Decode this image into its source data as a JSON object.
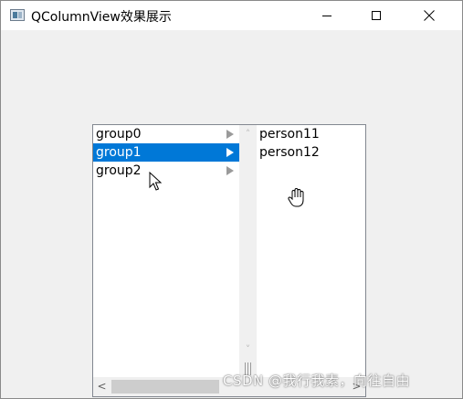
{
  "window": {
    "title": "QColumnView效果展示",
    "controls": {
      "minimize": "minimize-icon",
      "maximize": "maximize-icon",
      "close": "close-icon"
    }
  },
  "column_view": {
    "groups": [
      {
        "label": "group0",
        "selected": false
      },
      {
        "label": "group1",
        "selected": true
      },
      {
        "label": "group2",
        "selected": false
      }
    ],
    "children": [
      "person11",
      "person12"
    ],
    "selection_color": "#0078d7"
  },
  "scrollbars": {
    "vertical": {
      "up": "˄",
      "down": "˅"
    },
    "horizontal": {
      "left": "<",
      "right": ">"
    }
  },
  "cursors": {
    "arrow": "arrow-cursor-icon",
    "hand": "open-hand-cursor-icon"
  },
  "watermark": "CSDN @我行我素，向往自由"
}
